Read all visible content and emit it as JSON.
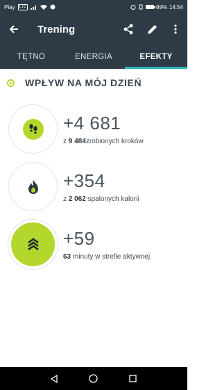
{
  "status_bar": {
    "carrier": "Play",
    "carrier_badge": "LTE",
    "battery_percent": "99%",
    "battery_level": 0.99,
    "time": "14:54"
  },
  "app_bar": {
    "title": "Trening",
    "icons": [
      "back-arrow",
      "share",
      "pencil",
      "more-vertical"
    ]
  },
  "tabs": [
    {
      "label": "TĘTNO",
      "active": false
    },
    {
      "label": "ENERGIA",
      "active": false
    },
    {
      "label": "EFEKTY",
      "active": true
    }
  ],
  "section": {
    "title": "WPŁYW NA MÓJ DZIEŃ"
  },
  "impacts": [
    {
      "icon": "footsteps-icon",
      "value": "+4 681",
      "prefix": "z",
      "bold": "9 484",
      "suffix": "zrobionych kroków"
    },
    {
      "icon": "flame-icon",
      "value": "+354",
      "prefix": "z",
      "bold": "2 062",
      "suffix": " spalonych kalorii"
    },
    {
      "icon": "active-zone-icon",
      "value": "+59",
      "prefix": "",
      "bold": "63",
      "suffix": " minuty w strefie aktywnej"
    }
  ],
  "colors": {
    "bar": "#2e3a46",
    "accent": "#2bb3b5",
    "green": "#b5d62b"
  }
}
